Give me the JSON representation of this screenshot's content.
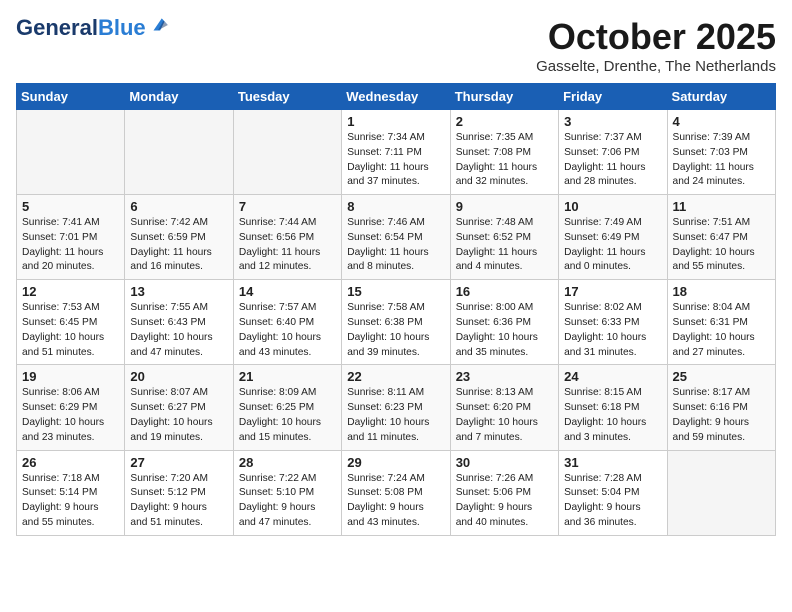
{
  "header": {
    "logo_line1": "General",
    "logo_line2": "Blue",
    "month_title": "October 2025",
    "location": "Gasselte, Drenthe, The Netherlands"
  },
  "weekdays": [
    "Sunday",
    "Monday",
    "Tuesday",
    "Wednesday",
    "Thursday",
    "Friday",
    "Saturday"
  ],
  "weeks": [
    [
      {
        "day": "",
        "info": ""
      },
      {
        "day": "",
        "info": ""
      },
      {
        "day": "",
        "info": ""
      },
      {
        "day": "1",
        "info": "Sunrise: 7:34 AM\nSunset: 7:11 PM\nDaylight: 11 hours\nand 37 minutes."
      },
      {
        "day": "2",
        "info": "Sunrise: 7:35 AM\nSunset: 7:08 PM\nDaylight: 11 hours\nand 32 minutes."
      },
      {
        "day": "3",
        "info": "Sunrise: 7:37 AM\nSunset: 7:06 PM\nDaylight: 11 hours\nand 28 minutes."
      },
      {
        "day": "4",
        "info": "Sunrise: 7:39 AM\nSunset: 7:03 PM\nDaylight: 11 hours\nand 24 minutes."
      }
    ],
    [
      {
        "day": "5",
        "info": "Sunrise: 7:41 AM\nSunset: 7:01 PM\nDaylight: 11 hours\nand 20 minutes."
      },
      {
        "day": "6",
        "info": "Sunrise: 7:42 AM\nSunset: 6:59 PM\nDaylight: 11 hours\nand 16 minutes."
      },
      {
        "day": "7",
        "info": "Sunrise: 7:44 AM\nSunset: 6:56 PM\nDaylight: 11 hours\nand 12 minutes."
      },
      {
        "day": "8",
        "info": "Sunrise: 7:46 AM\nSunset: 6:54 PM\nDaylight: 11 hours\nand 8 minutes."
      },
      {
        "day": "9",
        "info": "Sunrise: 7:48 AM\nSunset: 6:52 PM\nDaylight: 11 hours\nand 4 minutes."
      },
      {
        "day": "10",
        "info": "Sunrise: 7:49 AM\nSunset: 6:49 PM\nDaylight: 11 hours\nand 0 minutes."
      },
      {
        "day": "11",
        "info": "Sunrise: 7:51 AM\nSunset: 6:47 PM\nDaylight: 10 hours\nand 55 minutes."
      }
    ],
    [
      {
        "day": "12",
        "info": "Sunrise: 7:53 AM\nSunset: 6:45 PM\nDaylight: 10 hours\nand 51 minutes."
      },
      {
        "day": "13",
        "info": "Sunrise: 7:55 AM\nSunset: 6:43 PM\nDaylight: 10 hours\nand 47 minutes."
      },
      {
        "day": "14",
        "info": "Sunrise: 7:57 AM\nSunset: 6:40 PM\nDaylight: 10 hours\nand 43 minutes."
      },
      {
        "day": "15",
        "info": "Sunrise: 7:58 AM\nSunset: 6:38 PM\nDaylight: 10 hours\nand 39 minutes."
      },
      {
        "day": "16",
        "info": "Sunrise: 8:00 AM\nSunset: 6:36 PM\nDaylight: 10 hours\nand 35 minutes."
      },
      {
        "day": "17",
        "info": "Sunrise: 8:02 AM\nSunset: 6:33 PM\nDaylight: 10 hours\nand 31 minutes."
      },
      {
        "day": "18",
        "info": "Sunrise: 8:04 AM\nSunset: 6:31 PM\nDaylight: 10 hours\nand 27 minutes."
      }
    ],
    [
      {
        "day": "19",
        "info": "Sunrise: 8:06 AM\nSunset: 6:29 PM\nDaylight: 10 hours\nand 23 minutes."
      },
      {
        "day": "20",
        "info": "Sunrise: 8:07 AM\nSunset: 6:27 PM\nDaylight: 10 hours\nand 19 minutes."
      },
      {
        "day": "21",
        "info": "Sunrise: 8:09 AM\nSunset: 6:25 PM\nDaylight: 10 hours\nand 15 minutes."
      },
      {
        "day": "22",
        "info": "Sunrise: 8:11 AM\nSunset: 6:23 PM\nDaylight: 10 hours\nand 11 minutes."
      },
      {
        "day": "23",
        "info": "Sunrise: 8:13 AM\nSunset: 6:20 PM\nDaylight: 10 hours\nand 7 minutes."
      },
      {
        "day": "24",
        "info": "Sunrise: 8:15 AM\nSunset: 6:18 PM\nDaylight: 10 hours\nand 3 minutes."
      },
      {
        "day": "25",
        "info": "Sunrise: 8:17 AM\nSunset: 6:16 PM\nDaylight: 9 hours\nand 59 minutes."
      }
    ],
    [
      {
        "day": "26",
        "info": "Sunrise: 7:18 AM\nSunset: 5:14 PM\nDaylight: 9 hours\nand 55 minutes."
      },
      {
        "day": "27",
        "info": "Sunrise: 7:20 AM\nSunset: 5:12 PM\nDaylight: 9 hours\nand 51 minutes."
      },
      {
        "day": "28",
        "info": "Sunrise: 7:22 AM\nSunset: 5:10 PM\nDaylight: 9 hours\nand 47 minutes."
      },
      {
        "day": "29",
        "info": "Sunrise: 7:24 AM\nSunset: 5:08 PM\nDaylight: 9 hours\nand 43 minutes."
      },
      {
        "day": "30",
        "info": "Sunrise: 7:26 AM\nSunset: 5:06 PM\nDaylight: 9 hours\nand 40 minutes."
      },
      {
        "day": "31",
        "info": "Sunrise: 7:28 AM\nSunset: 5:04 PM\nDaylight: 9 hours\nand 36 minutes."
      },
      {
        "day": "",
        "info": ""
      }
    ]
  ]
}
